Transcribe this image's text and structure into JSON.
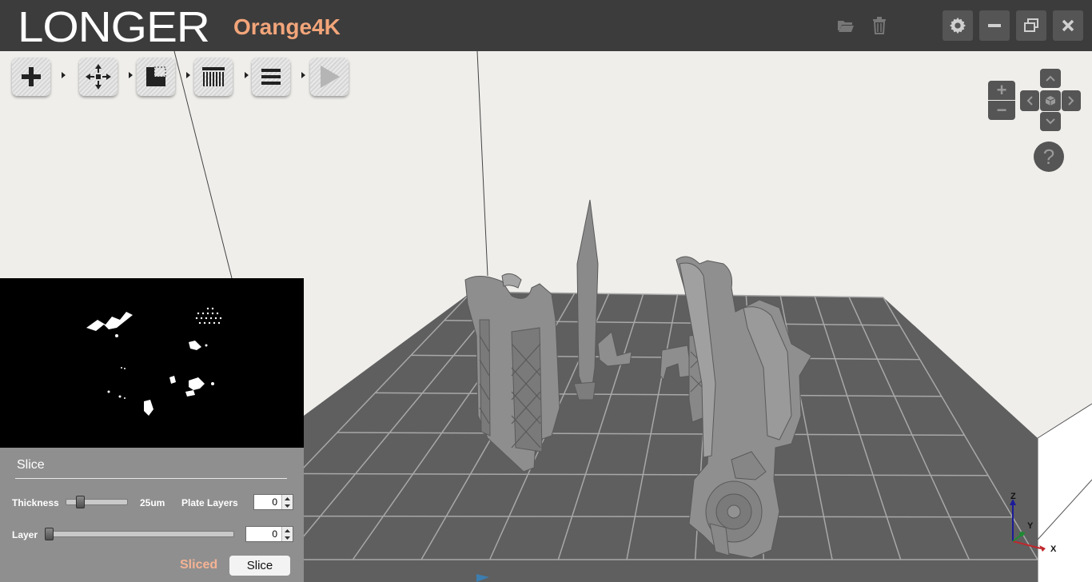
{
  "app": {
    "logo": "LONGER",
    "model": "Orange4K"
  },
  "titlebar": {
    "icons": [
      "folder-open-icon",
      "trash-icon"
    ],
    "window_buttons": [
      "gear-icon",
      "minimize-icon",
      "restore-icon",
      "close-icon"
    ]
  },
  "toolbar": {
    "tools": [
      "add-icon",
      "move-icon",
      "support-icon",
      "slice-layers-icon",
      "layers-icon",
      "play-icon"
    ]
  },
  "nav": {
    "zoom_in": "+",
    "zoom_out": "−",
    "help": "?"
  },
  "slice": {
    "title": "Slice",
    "thickness_label": "Thickness",
    "thickness_value": "25um",
    "plate_layers_label": "Plate Layers",
    "plate_layers_value": "0",
    "layer_label": "Layer",
    "layer_value": "0",
    "status": "Sliced",
    "button": "Slice",
    "thickness_slider_level": 0.2,
    "layer_slider_level": 0.0
  },
  "axes": {
    "x": "X",
    "y": "Y",
    "z": "Z"
  },
  "colors": {
    "titlebar": "#3c3c3c",
    "accent": "#f2a57a",
    "platform": "#5f5f5f",
    "model": "#8c8c8c"
  }
}
